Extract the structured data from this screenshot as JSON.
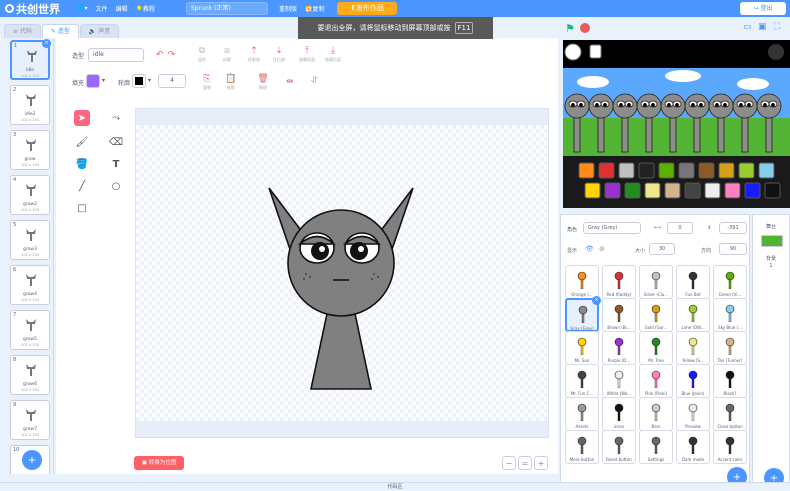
{
  "topbar": {
    "logo": "共创世界",
    "menu_file": "文件",
    "menu_edit": "编辑",
    "menu_tutorial": "教程",
    "project_title": "Sprunk (正常)",
    "remix_label": "重制版",
    "share_label": "复制",
    "publish_label": "发布作品",
    "login_label": "登出"
  },
  "fullscreen_hint": {
    "text": "要退出全屏，请将鼠标移动到屏幕顶部或按",
    "key": "F11"
  },
  "tabs": {
    "code": "代码",
    "costume": "造型",
    "sound": "声音"
  },
  "costumes": [
    {
      "num": "1",
      "name": "idle",
      "size": "102 x 134"
    },
    {
      "num": "2",
      "name": "idle2",
      "size": "102 x 134"
    },
    {
      "num": "3",
      "name": "grow",
      "size": "102 x 134"
    },
    {
      "num": "4",
      "name": "grow2",
      "size": "102 x 134"
    },
    {
      "num": "5",
      "name": "grow3",
      "size": "102 x 134"
    },
    {
      "num": "6",
      "name": "grow4",
      "size": "102 x 134"
    },
    {
      "num": "7",
      "name": "grow5",
      "size": "102 x 134"
    },
    {
      "num": "8",
      "name": "grow6",
      "size": "102 x 134"
    },
    {
      "num": "9",
      "name": "grow7",
      "size": "102 x 134"
    },
    {
      "num": "10",
      "name": "",
      "size": ""
    }
  ],
  "editor": {
    "costume_label": "造型",
    "costume_name": "idle",
    "fill_label": "填充",
    "outline_label": "轮廓",
    "outline_width": "4",
    "fill_color": "#9966ff",
    "btn_group": "组合",
    "btn_ungroup": "拆散",
    "btn_forward": "往前放",
    "btn_backward": "往后放",
    "btn_front": "放最前面",
    "btn_back": "放最后面",
    "btn_copy": "复制",
    "btn_paste": "粘贴",
    "btn_delete": "删除",
    "convert_bitmap": "转换为位图"
  },
  "sprite_info": {
    "sprite_label": "角色",
    "sprite_name": "Gray (Grey)",
    "x_label": "x",
    "x_value": "0",
    "y_label": "y",
    "y_value": "-391",
    "show_label": "显示",
    "size_label": "大小",
    "size_value": "30",
    "direction_label": "方向",
    "direction_value": "90"
  },
  "sprites": [
    "Orange (...",
    "Red (Raddy)",
    "Silver (Clu...",
    "Fun Bot",
    "Green (Vi...",
    "Gray (Grey)",
    "Brown (Br...",
    "Gold (Gar...",
    "Lime (OW...",
    "Sky Blue (...",
    "Mr. Sun",
    "Purple (D...",
    "Mr. Tree",
    "Yellow (S...",
    "Tan (Tunner)",
    "Mr. Fun C...",
    "White (Wa...",
    "Pink (Pinki)",
    "Blue (Jevin)",
    "Black?",
    "Assets",
    "icons",
    "Bars",
    "Preview",
    "Close button",
    "More button",
    "Reset button",
    "Settings",
    "Dark mode",
    "Accent color"
  ],
  "stage_column": {
    "label": "舞台",
    "backdrops_label": "背景",
    "backdrops_count": "1"
  },
  "bottom": {
    "text": "代码区"
  }
}
